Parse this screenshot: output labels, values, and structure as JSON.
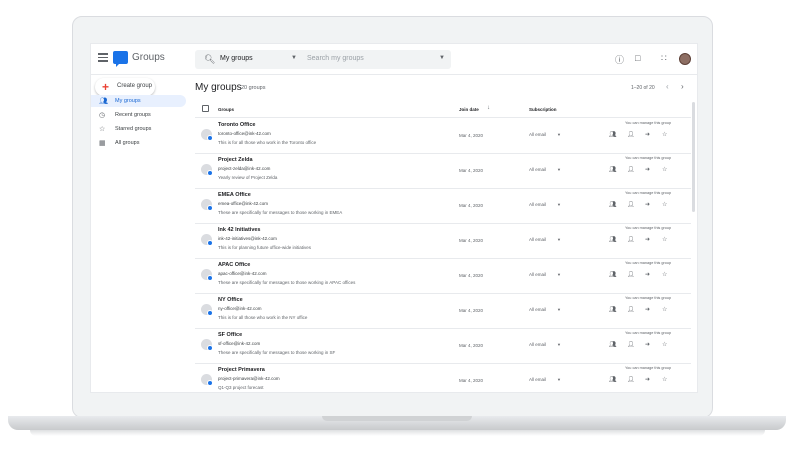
{
  "app": {
    "name": "Groups",
    "menu_icon": "hamburger-menu-icon",
    "logo_icon": "groups-logo-icon"
  },
  "search": {
    "scope_label": "My groups",
    "placeholder": "Search my groups"
  },
  "topbar_icons": [
    "help-icon",
    "feedback-icon",
    "apps-grid-icon",
    "account-avatar"
  ],
  "sidebar": {
    "create_label": "Create group",
    "items": [
      {
        "label": "My groups",
        "icon": "people-icon",
        "active": true
      },
      {
        "label": "Recent groups",
        "icon": "clock-icon",
        "active": false
      },
      {
        "label": "Starred groups",
        "icon": "star-icon",
        "active": false
      },
      {
        "label": "All groups",
        "icon": "building-icon",
        "active": false
      }
    ]
  },
  "content": {
    "title": "My groups",
    "count": "20 groups",
    "pagination": "1–20 of 20"
  },
  "table": {
    "headers": {
      "group": "Groups",
      "join_date": "Join date",
      "subscription": "Subscription"
    },
    "rows": [
      {
        "name": "Toronto Office",
        "email": "toronto-office@ink-42.com",
        "description": "This is for all those who work in the Toronto office",
        "join_date": "Mar 4, 2020",
        "subscription": "All email",
        "manage": "You can manage this group"
      },
      {
        "name": "Project Zelda",
        "email": "project-zelda@ink-42.com",
        "description": "Yearly review of Project Zelda",
        "join_date": "Mar 4, 2020",
        "subscription": "All email",
        "manage": "You can manage this group"
      },
      {
        "name": "EMEA Office",
        "email": "emea-office@ink-42.com",
        "description": "These are specifically for messages to those working in EMEA",
        "join_date": "Mar 4, 2020",
        "subscription": "All email",
        "manage": "You can manage this group"
      },
      {
        "name": "Ink 42 Initiatives",
        "email": "ink-42-initiatives@ink-42.com",
        "description": "This is for planning future office-wide initiatives",
        "join_date": "Mar 4, 2020",
        "subscription": "All email",
        "manage": "You can manage this group"
      },
      {
        "name": "APAC Office",
        "email": "apac-office@ink-42.com",
        "description": "These are specifically for messages to those working in APAC offices",
        "join_date": "Mar 4, 2020",
        "subscription": "All email",
        "manage": "You can manage this group"
      },
      {
        "name": "NY Office",
        "email": "ny-office@ink-42.com",
        "description": "This is for all those who work in the NY office",
        "join_date": "Mar 4, 2020",
        "subscription": "All email",
        "manage": "You can manage this group"
      },
      {
        "name": "SF Office",
        "email": "sf-office@ink-42.com",
        "description": "These are specifically for messages to those working in SF",
        "join_date": "Mar 4, 2020",
        "subscription": "All email",
        "manage": "You can manage this group"
      },
      {
        "name": "Project Primavera",
        "email": "project-primavera@ink-42.com",
        "description": "Q1-Q3 project forecast",
        "join_date": "Mar 4, 2020",
        "subscription": "All email",
        "manage": "You can manage this group"
      }
    ]
  },
  "colors": {
    "accent": "#1a73e8",
    "active_bg": "#e8f0fe",
    "text": "#202124",
    "secondary": "#5f6368"
  }
}
